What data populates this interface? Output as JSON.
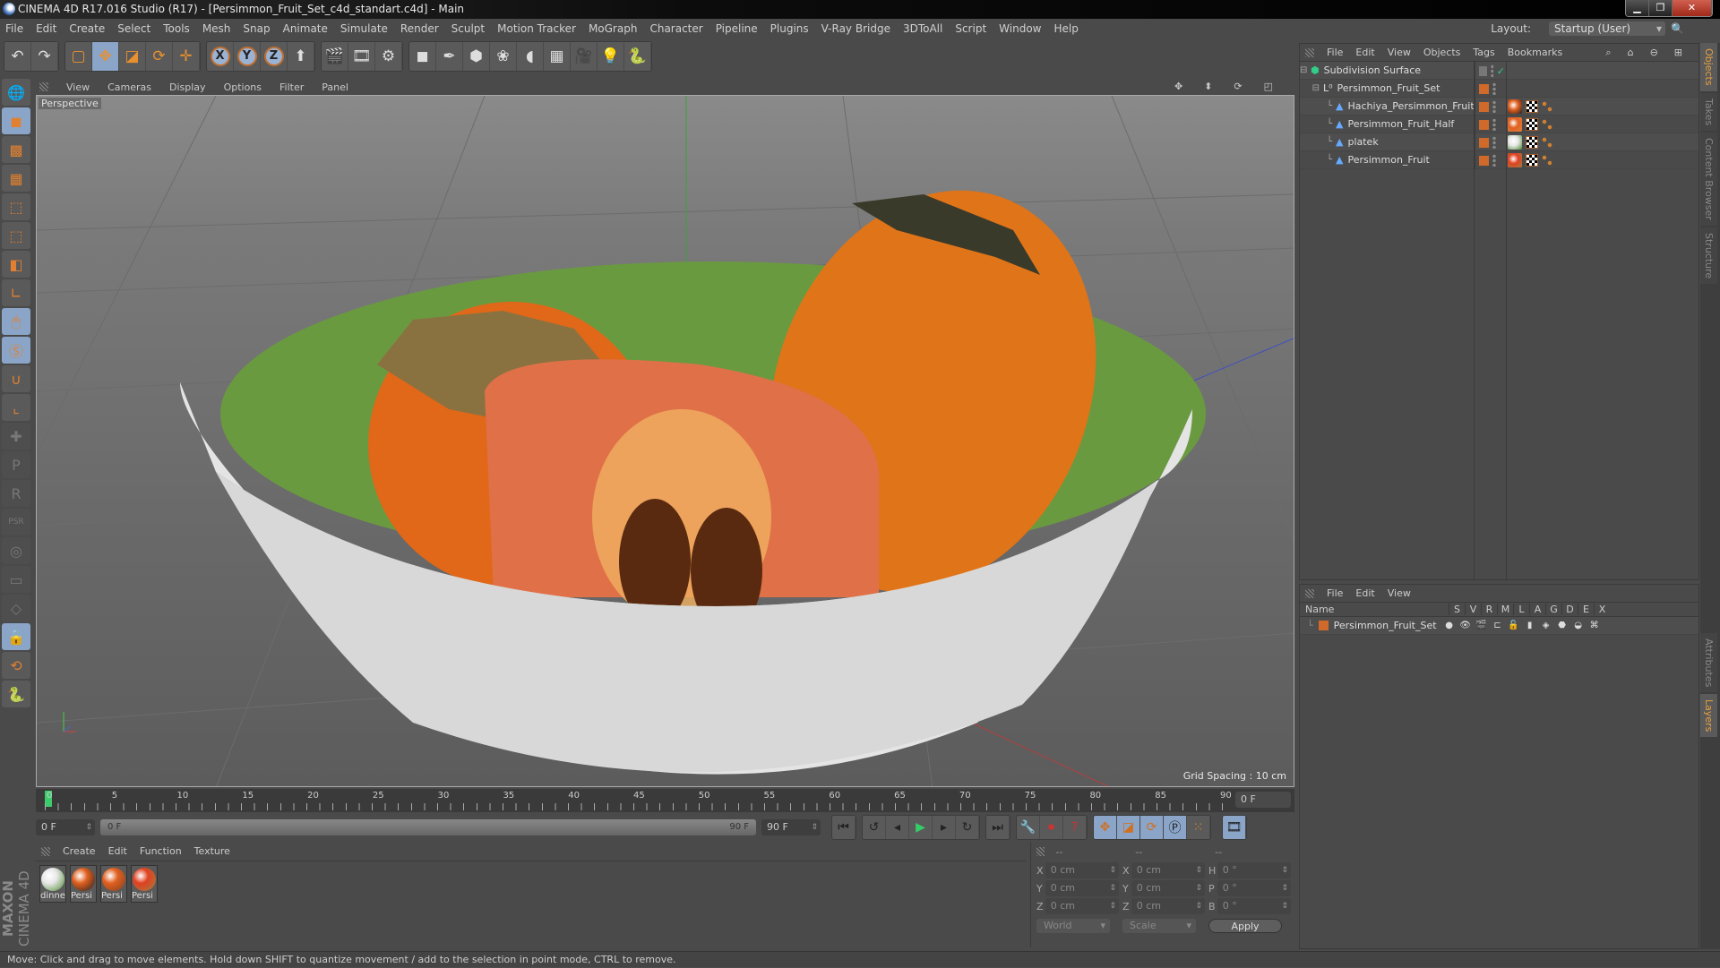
{
  "window": {
    "title": "CINEMA 4D R17.016 Studio (R17) - [Persimmon_Fruit_Set_c4d_standart.c4d] - Main",
    "controls": [
      "minimize",
      "maximize",
      "close"
    ]
  },
  "menubar": {
    "items": [
      "File",
      "Edit",
      "Create",
      "Select",
      "Tools",
      "Mesh",
      "Snap",
      "Animate",
      "Simulate",
      "Render",
      "Sculpt",
      "Motion Tracker",
      "MoGraph",
      "Character",
      "Pipeline",
      "Plugins",
      "V-Ray Bridge",
      "3DToAll",
      "Script",
      "Window",
      "Help"
    ],
    "layout_label": "Layout:",
    "layout_value": "Startup (User)"
  },
  "toolbar": {
    "groups": [
      [
        {
          "icon": "undo-icon",
          "glyph": "↶"
        },
        {
          "icon": "redo-icon",
          "glyph": "↷"
        }
      ],
      [
        {
          "icon": "live-selection-icon",
          "glyph": "▢"
        },
        {
          "icon": "move-icon",
          "glyph": "✥",
          "active": true
        },
        {
          "icon": "scale-icon",
          "glyph": "◪"
        },
        {
          "icon": "rotate-icon",
          "glyph": "⟳"
        },
        {
          "icon": "move-alt-icon",
          "glyph": "✛"
        }
      ],
      [
        {
          "icon": "x-axis-icon",
          "axis": "X"
        },
        {
          "icon": "y-axis-icon",
          "axis": "Y"
        },
        {
          "icon": "z-axis-icon",
          "axis": "Z"
        },
        {
          "icon": "coordinate-system-icon",
          "glyph": "⬆"
        }
      ],
      [
        {
          "icon": "render-view-icon",
          "glyph": "🎬"
        },
        {
          "icon": "render-picture-viewer-icon",
          "glyph": "🎞"
        },
        {
          "icon": "render-settings-icon",
          "glyph": "⚙"
        }
      ],
      [
        {
          "icon": "cube-icon",
          "glyph": "◼"
        },
        {
          "icon": "pen-spline-icon",
          "glyph": "✒"
        },
        {
          "icon": "subdivision-icon",
          "glyph": "⬢"
        },
        {
          "icon": "cloner-icon",
          "glyph": "❀"
        },
        {
          "icon": "deformer-icon",
          "glyph": "◖"
        },
        {
          "icon": "floor-icon",
          "glyph": "▦"
        },
        {
          "icon": "camera-icon",
          "glyph": "🎥"
        },
        {
          "icon": "light-icon",
          "glyph": "💡"
        },
        {
          "icon": "python-icon",
          "glyph": "🐍"
        }
      ]
    ]
  },
  "left_tools": [
    {
      "icon": "make-editable-icon",
      "glyph": "🌐",
      "state": "normal"
    },
    {
      "icon": "model-mode-icon",
      "glyph": "◼",
      "state": "active"
    },
    {
      "icon": "texture-mode-icon",
      "glyph": "▩",
      "state": "normal"
    },
    {
      "icon": "workplane-mode-icon",
      "glyph": "▦",
      "state": "normal"
    },
    {
      "icon": "points-mode-icon",
      "glyph": "⬚",
      "state": "normal"
    },
    {
      "icon": "edges-mode-icon",
      "glyph": "⬚",
      "state": "normal"
    },
    {
      "icon": "polygons-mode-icon",
      "glyph": "◧",
      "state": "normal"
    },
    {
      "icon": "axis-mode-icon",
      "glyph": "∟",
      "state": "normal"
    },
    {
      "icon": "tweak-mode-icon",
      "glyph": "🖱",
      "state": "active"
    },
    {
      "icon": "solo-icon",
      "glyph": "Ⓢ",
      "state": "active"
    },
    {
      "icon": "snap-icon",
      "glyph": "∪",
      "state": "normal"
    },
    {
      "icon": "workplane-icon",
      "glyph": "⌞",
      "state": "normal"
    },
    {
      "icon": "key-all-icon",
      "glyph": "✚",
      "state": "dim"
    },
    {
      "icon": "key-position-icon",
      "glyph": "P",
      "state": "dim"
    },
    {
      "icon": "key-rotation-icon",
      "glyph": "R",
      "state": "dim"
    },
    {
      "icon": "key-psr-icon",
      "glyph": "PSR",
      "state": "dim"
    },
    {
      "icon": "key-point-icon",
      "glyph": "◎",
      "state": "dim"
    },
    {
      "icon": "key-param-icon",
      "glyph": "▭",
      "state": "dim"
    },
    {
      "icon": "key-pla-icon",
      "glyph": "◇",
      "state": "dim"
    },
    {
      "icon": "lock-workplane-icon",
      "glyph": "🔒",
      "state": "active"
    },
    {
      "icon": "workplane-rotate-icon",
      "glyph": "⟲",
      "state": "normal"
    },
    {
      "icon": "python-script-icon",
      "glyph": "🐍",
      "state": "normal"
    }
  ],
  "viewport": {
    "menu": [
      "View",
      "Cameras",
      "Display",
      "Options",
      "Filter",
      "Panel"
    ],
    "camera_label": "Perspective",
    "grid_spacing": "Grid Spacing : 10 cm",
    "nav_icons": [
      "move-view-icon",
      "zoom-view-icon",
      "rotate-view-icon",
      "maximize-view-icon"
    ]
  },
  "timeline": {
    "ticks": [
      "0",
      "5",
      "10",
      "15",
      "20",
      "25",
      "30",
      "35",
      "40",
      "45",
      "50",
      "55",
      "60",
      "65",
      "70",
      "75",
      "80",
      "85",
      "90"
    ],
    "current_frame": "0 F",
    "start_field": "0 F",
    "range_start": "0 F",
    "range_end": "90 F",
    "end_field": "90 F"
  },
  "transport": {
    "buttons": [
      "go-to-start-icon",
      "previous-key-icon",
      "previous-frame-icon",
      "play-icon",
      "next-frame-icon",
      "next-key-icon",
      "go-to-end-icon"
    ],
    "record": [
      "motion-record-icon",
      "record-active-icon",
      "autokey-icon"
    ],
    "keys": [
      "key-position-icon",
      "key-scale-icon",
      "key-rotation-icon",
      "key-parameter-icon",
      "key-pla-icon"
    ],
    "timeline_icon": "timeline-icon"
  },
  "materials": {
    "menu": [
      "Create",
      "Edit",
      "Function",
      "Texture"
    ],
    "items": [
      {
        "label": "dinne",
        "color": "#e8e8e8",
        "accent": "#4a8a30"
      },
      {
        "label": "Persi",
        "color": "#e06020",
        "accent": "#202020"
      },
      {
        "label": "Persi",
        "color": "#e06020",
        "accent": "#804020"
      },
      {
        "label": "Persi",
        "color": "#e04020",
        "accent": "#a08040"
      }
    ]
  },
  "brand": {
    "maxon": "MAXON",
    "product": "CINEMA 4D"
  },
  "coordinates": {
    "headers": [
      "--",
      "--",
      "--"
    ],
    "rows": [
      {
        "l1": "X",
        "v1": "0 cm",
        "l2": "X",
        "v2": "0 cm",
        "l3": "H",
        "v3": "0 °"
      },
      {
        "l1": "Y",
        "v1": "0 cm",
        "l2": "Y",
        "v2": "0 cm",
        "l3": "P",
        "v3": "0 °"
      },
      {
        "l1": "Z",
        "v1": "0 cm",
        "l2": "Z",
        "v2": "0 cm",
        "l3": "B",
        "v3": "0 °"
      }
    ],
    "space": "World",
    "mode": "Scale",
    "apply": "Apply"
  },
  "objects_panel": {
    "menu": [
      "File",
      "Edit",
      "View",
      "Objects",
      "Tags",
      "Bookmarks"
    ],
    "tree": [
      {
        "name": "Subdivision Surface",
        "depth": 0,
        "icon": "subdivision-surface-icon",
        "expanded": true,
        "tags": []
      },
      {
        "name": "Persimmon_Fruit_Set",
        "depth": 1,
        "icon": "null-object-icon",
        "expanded": true,
        "tags": []
      },
      {
        "name": "Hachiya_Persimmon_Fruit",
        "depth": 2,
        "icon": "polygon-object-icon",
        "tags": [
          "#e06020",
          "#202020"
        ]
      },
      {
        "name": "Persimmon_Fruit_Half",
        "depth": 2,
        "icon": "polygon-object-icon",
        "tags": [
          "#e06020",
          "#e08040"
        ]
      },
      {
        "name": "platek",
        "depth": 2,
        "icon": "polygon-object-icon",
        "tags": [
          "#e8e8e8",
          "#4a8a30"
        ]
      },
      {
        "name": "Persimmon_Fruit",
        "depth": 2,
        "icon": "polygon-object-icon",
        "tags": [
          "#e04020",
          "#a08040"
        ]
      }
    ]
  },
  "layers_panel": {
    "menu": [
      "File",
      "Edit",
      "View"
    ],
    "columns": [
      "Name",
      "S",
      "V",
      "R",
      "M",
      "L",
      "A",
      "G",
      "D",
      "E",
      "X"
    ],
    "rows": [
      {
        "name": "Persimmon_Fruit_Set",
        "color": "#d06a2a"
      }
    ]
  },
  "side_tabs": [
    {
      "label": "Objects",
      "active": true
    },
    {
      "label": "Takes",
      "active": false
    },
    {
      "label": "Content Browser",
      "active": false
    },
    {
      "label": "Structure",
      "active": false
    },
    {
      "label": "Attributes",
      "active": false
    },
    {
      "label": "Layers",
      "active": true
    }
  ],
  "status": "Move: Click and drag to move elements. Hold down SHIFT to quantize movement / add to the selection in point mode, CTRL to remove.",
  "colors": {
    "accent_blue": "#8aa5c8",
    "accent_orange": "#d06a2a",
    "tab_active": "#e8a040"
  }
}
